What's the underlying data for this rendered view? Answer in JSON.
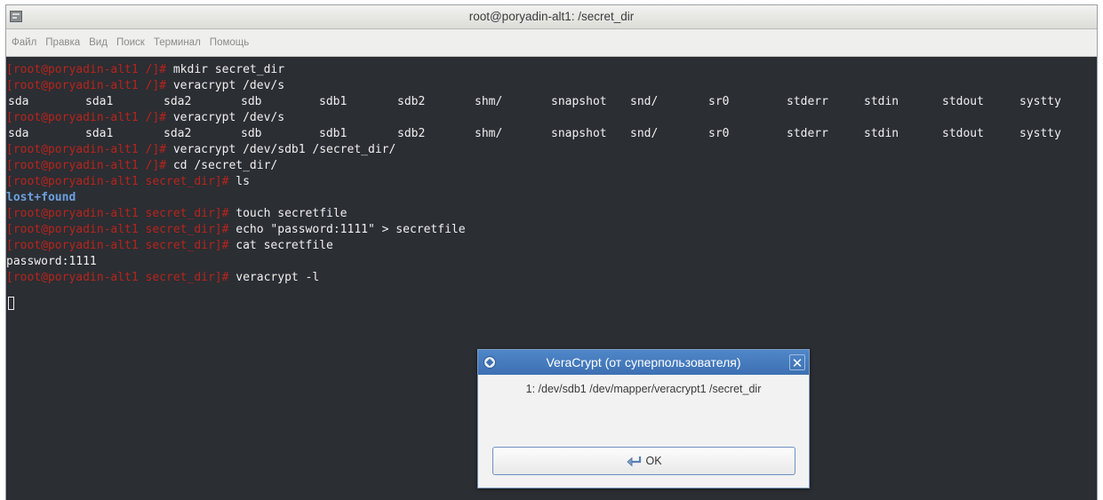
{
  "window": {
    "title": "root@poryadin-alt1: /secret_dir",
    "icon": "terminal-icon"
  },
  "menu": [
    "Файл",
    "Правка",
    "Вид",
    "Поиск",
    "Терминал",
    "Помощь"
  ],
  "colors": {
    "terminal_bg": "#2b2e33",
    "prompt": "#b8241c",
    "text": "#f0f0f0",
    "directory": "#6ea0e0",
    "dialog_title": "#3d70b2"
  },
  "terminal": {
    "prompts": {
      "root_dir": "[root@poryadin-alt1 /]# ",
      "secret_dir": "[root@poryadin-alt1 secret_dir]# "
    },
    "commands": {
      "mkdir": "mkdir secret_dir",
      "veracrypt_tab1": "veracrypt /dev/s",
      "veracrypt_tab2": "veracrypt /dev/s",
      "veracrypt_mount": "veracrypt /dev/sdb1 /secret_dir/",
      "cd": "cd /secret_dir/",
      "ls": "ls",
      "touch": "touch secretfile",
      "echo": "echo \"password:1111\" > secretfile",
      "cat": "cat secretfile",
      "veracrypt_list": "veracrypt -l"
    },
    "completion_list": [
      "sda",
      "sda1",
      "sda2",
      "sdb",
      "sdb1",
      "sdb2",
      "shm/",
      "snapshot",
      "snd/",
      "sr0",
      "stderr",
      "stdin",
      "stdout",
      "systty"
    ],
    "ls_output": "lost+found",
    "cat_output": "password:1111"
  },
  "dialog": {
    "title": "VeraCrypt (от суперпользователя)",
    "message": "1: /dev/sdb1 /dev/mapper/veracrypt1 /secret_dir",
    "ok_label": "OK",
    "close_glyph": "✕"
  }
}
